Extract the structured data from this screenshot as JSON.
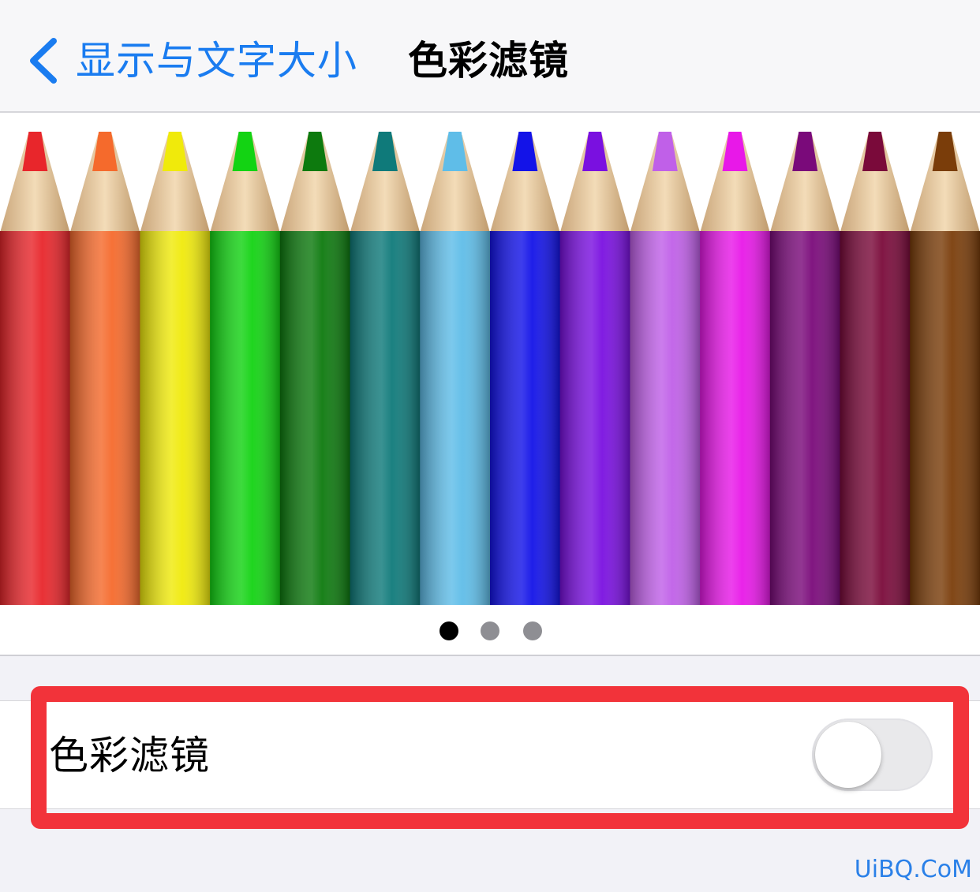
{
  "nav": {
    "back_label": "显示与文字大小",
    "title": "色彩滤镜"
  },
  "carousel": {
    "pencil_colors": [
      "#e8262b",
      "#f56a2c",
      "#f0ea0b",
      "#13d313",
      "#0d7a0e",
      "#0f7a7a",
      "#5fbde8",
      "#1313e8",
      "#7a10e0",
      "#c060e8",
      "#e818e8",
      "#7a0a7a",
      "#7a0a3a",
      "#7a3d0a"
    ],
    "page_count": 3,
    "active_page": 1
  },
  "settings": {
    "color_filters_label": "色彩滤镜",
    "color_filters_enabled": false
  },
  "colors": {
    "accent": "#1a7cf0",
    "highlight": "#f2333a"
  },
  "watermark": "UiBQ.CoM"
}
